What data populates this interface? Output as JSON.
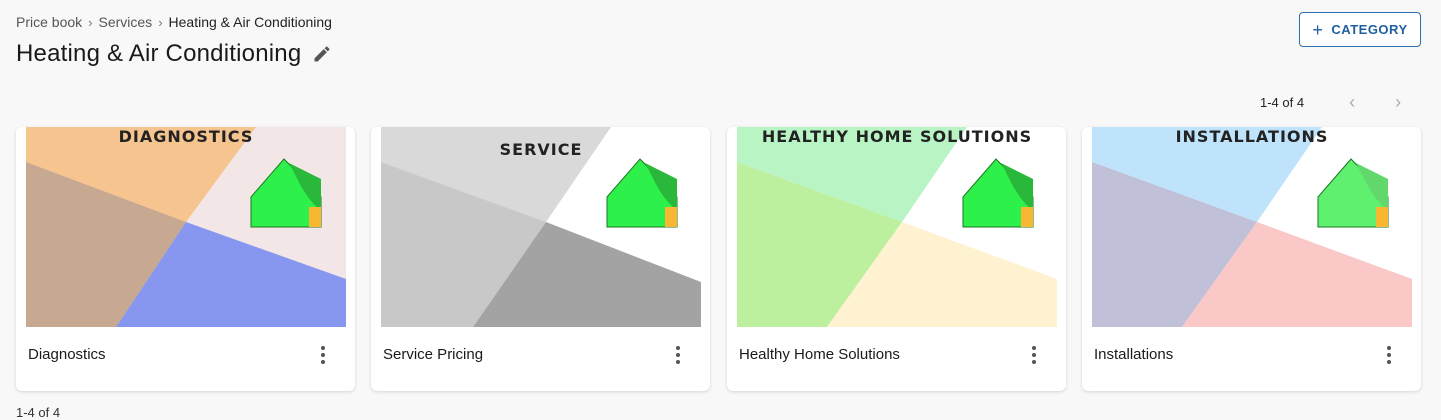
{
  "breadcrumb": {
    "items": [
      "Price book",
      "Services",
      "Heating & Air Conditioning"
    ],
    "separator": "›"
  },
  "page_title": "Heating & Air Conditioning",
  "edit_icon": "pencil-icon",
  "category_button": {
    "icon": "+",
    "label": "CATEGORY"
  },
  "pagination": {
    "range": "1-4 of 4",
    "prev_icon": "‹",
    "next_icon": "›"
  },
  "bottom_pagination": {
    "range": "1-4 of 4"
  },
  "cards": [
    {
      "label": "Diagnostics",
      "image_title": "DIAGNOSTICS",
      "menu_icon": "more-vert-icon",
      "colors": [
        "#f6c58f",
        "#c7a891",
        "#8797ef",
        "#f2e6e6"
      ]
    },
    {
      "label": "Service Pricing",
      "image_title": "SERVICE",
      "menu_icon": "more-vert-icon",
      "colors": [
        "#d9d9d9",
        "#c8c8c8",
        "#a3a3a3",
        "#ffffff"
      ]
    },
    {
      "label": "Healthy Home Solutions",
      "image_title": "HEALTHY HOME SOLUTIONS",
      "menu_icon": "more-vert-icon",
      "colors": [
        "#b9f5c4",
        "#bcef9e",
        "#fff2d0",
        "#ffffff"
      ]
    },
    {
      "label": "Installations",
      "image_title": "INSTALLATIONS",
      "menu_icon": "more-vert-icon",
      "colors": [
        "#bfe3fb",
        "#c0c0d9",
        "#fbc8c8",
        "#ffffff"
      ]
    }
  ]
}
